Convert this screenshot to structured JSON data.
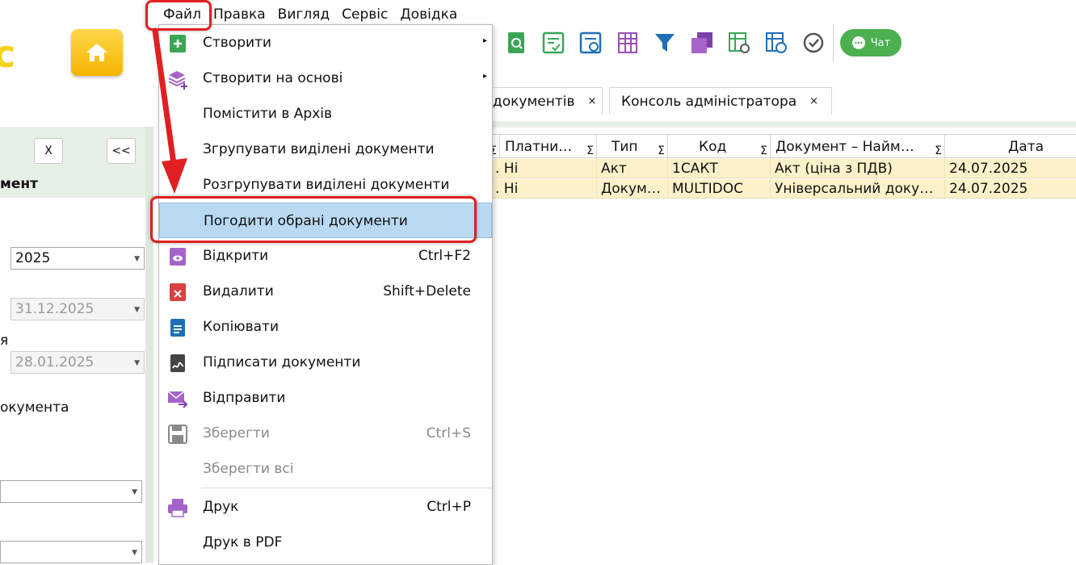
{
  "menubar": {
    "items": [
      "Файл",
      "Правка",
      "Вигляд",
      "Сервіс",
      "Довідка"
    ]
  },
  "toolbar": {
    "chat_label": "Чат"
  },
  "tabs": [
    {
      "label": "документів",
      "close": "×"
    },
    {
      "label": "Консоль адміністратора",
      "close": "×"
    }
  ],
  "left_panel": {
    "close_btn": "X",
    "collapse_btn": "<<",
    "heading": "мент",
    "year": "2025",
    "date_from": "31.12.2025",
    "label_ya": "я",
    "date_to": "28.01.2025",
    "label_doc": "окумента"
  },
  "grid": {
    "columns": [
      {
        "label": "",
        "sum": "Σ"
      },
      {
        "label": "Платни…",
        "sum": "Σ"
      },
      {
        "label": "Тип",
        "sum": "Σ"
      },
      {
        "label": "Код",
        "sum": "Σ"
      },
      {
        "label": "Документ – Найм…",
        "sum": "Σ"
      },
      {
        "label": "Дата",
        "sum": ""
      }
    ],
    "rows": [
      {
        "c0": "",
        "payer": ". Ні",
        "type": "Акт",
        "code": "1САКТ",
        "doc": "Акт (ціна з ПДВ)",
        "date": "24.07.2025"
      },
      {
        "c0": "",
        "payer": ". Ні",
        "type": "Докум…",
        "code": "MULTIDOC",
        "doc": "Універсальний доку…",
        "date": "24.07.2025"
      }
    ]
  },
  "file_menu": {
    "items": [
      {
        "label": "Створити",
        "shortcut": "",
        "submenu": "▸"
      },
      {
        "label": "Створити на основі",
        "shortcut": "",
        "submenu": "▸"
      },
      {
        "label": "Помістити в Архів",
        "shortcut": ""
      },
      {
        "label": "Згрупувати виділені документи",
        "shortcut": ""
      },
      {
        "label": "Розгрупувати виділені документи",
        "shortcut": ""
      },
      {
        "label": "Погодити обрані документи",
        "shortcut": ""
      },
      {
        "label": "Відкрити",
        "shortcut": "Ctrl+F2"
      },
      {
        "label": "Видалити",
        "shortcut": "Shift+Delete"
      },
      {
        "label": "Копіювати",
        "shortcut": ""
      },
      {
        "label": "Підписати документи",
        "shortcut": ""
      },
      {
        "label": "Відправити",
        "shortcut": ""
      },
      {
        "label": "Зберегти",
        "shortcut": "Ctrl+S"
      },
      {
        "label": "Зберегти всі",
        "shortcut": ""
      },
      {
        "label": "Друк",
        "shortcut": "Ctrl+P"
      },
      {
        "label": "Друк в PDF",
        "shortcut": ""
      }
    ]
  },
  "colors": {
    "accent_red": "#e02020",
    "highlight": "#b9d9f2",
    "row_bg": "#fdf1c9",
    "chat_green": "#4caf50",
    "panel_green": "#e7f0e6"
  }
}
